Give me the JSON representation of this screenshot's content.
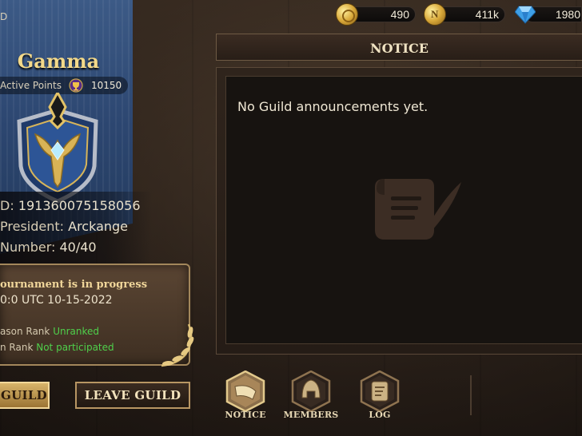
{
  "currencies": [
    {
      "name": "gold-coins",
      "value": "490",
      "icon": "gold-coin-icon"
    },
    {
      "name": "n-coins",
      "value": "411k",
      "icon": "n-coin-icon"
    },
    {
      "name": "diamonds",
      "value": "1980",
      "icon": "diamond-icon"
    }
  ],
  "guild": {
    "partial_top_text": "D",
    "name": "Gamma",
    "active_points_label": "Active Points",
    "active_points_value": "10150",
    "id_label": "D:",
    "id_value": "191360075158056",
    "president_label": "President:",
    "president_value": "Arckange",
    "number_label": "Number:",
    "number_value": "40/40"
  },
  "tournament": {
    "title": "ournament is in progress",
    "date": "0:0 UTC 10-15-2022",
    "season_rank_label": "ason Rank",
    "season_rank_value": "Unranked",
    "rank_label": "n Rank",
    "rank_value": "Not participated"
  },
  "buttons": {
    "guild_label": "GUILD",
    "leave_label": "LEAVE GUILD"
  },
  "notice": {
    "title": "NOTICE",
    "message": "No Guild announcements yet."
  },
  "tabs": [
    {
      "label": "NOTICE",
      "icon": "horn-icon",
      "selected": true
    },
    {
      "label": "MEMBERS",
      "icon": "helmet-icon",
      "selected": false
    },
    {
      "label": "LOG",
      "icon": "scroll-icon",
      "selected": false
    }
  ],
  "colors": {
    "accent_gold": "#f3d98a",
    "status_green": "#4fd04b",
    "banner_blue": "#2c4670"
  }
}
